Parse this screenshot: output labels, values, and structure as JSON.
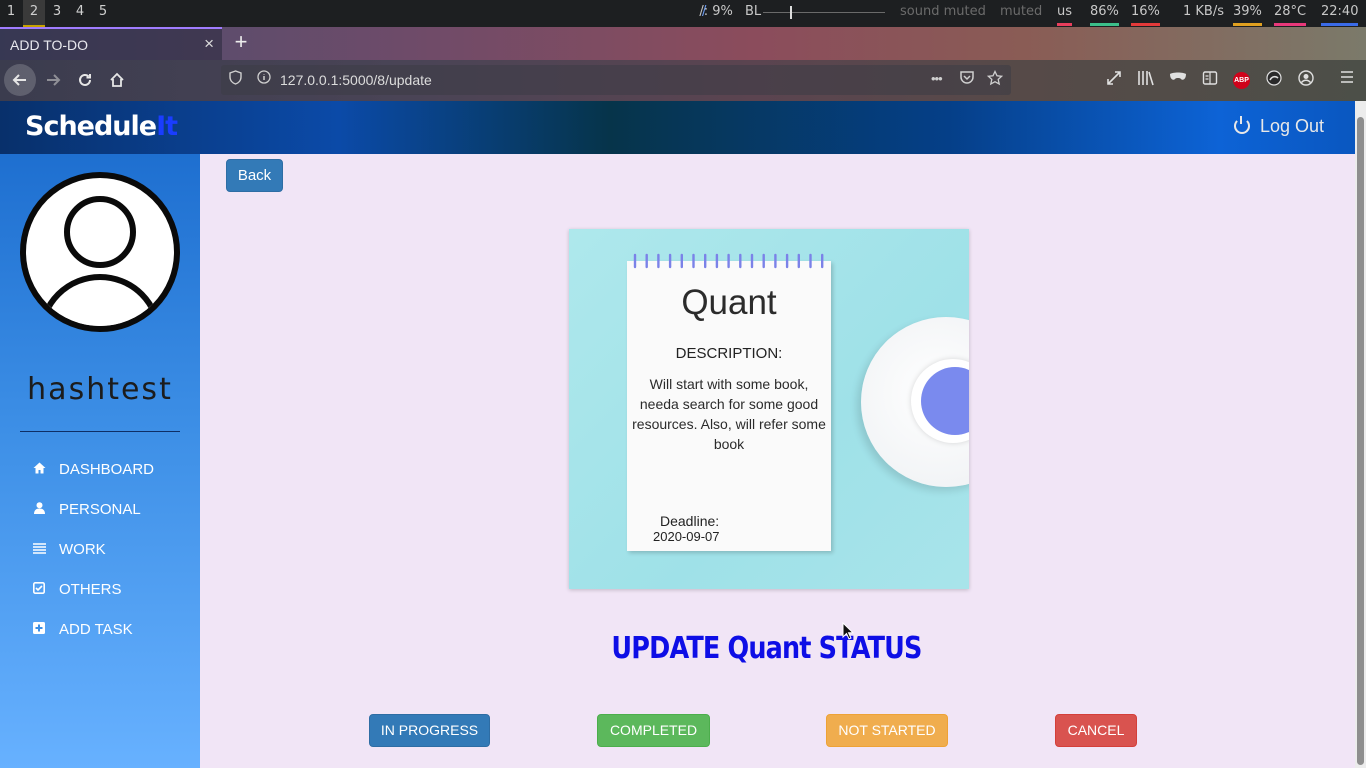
{
  "system_bar": {
    "workspaces": [
      "1",
      "2",
      "3",
      "4",
      "5"
    ],
    "active_workspace": "2",
    "cpu_label": "/: 9%",
    "brightness_label": "BL",
    "sound_label": "sound muted",
    "mic_label": "muted",
    "keyboard_layout": "us",
    "memory": "86%",
    "swap": "16%",
    "network": "1 KB/s",
    "battery": "39%",
    "temperature": "28°C",
    "clock": "22:40"
  },
  "browser": {
    "tab_title": "ADD TO-DO",
    "tab_close": "×",
    "new_tab": "+",
    "url": "127.0.0.1:5000/8/update",
    "url_more": "•••"
  },
  "app": {
    "brand_main": "Schedule",
    "brand_accent": "It",
    "logout_label": "Log Out"
  },
  "sidebar": {
    "username": "hashtest",
    "items": [
      {
        "label": "DASHBOARD",
        "icon": "home-icon"
      },
      {
        "label": "PERSONAL",
        "icon": "user-icon"
      },
      {
        "label": "WORK",
        "icon": "list-icon"
      },
      {
        "label": "OTHERS",
        "icon": "check-square-icon"
      },
      {
        "label": "ADD TASK",
        "icon": "plus-square-icon"
      }
    ]
  },
  "main": {
    "back_label": "Back",
    "task": {
      "title": "Quant",
      "description_label": "DESCRIPTION:",
      "description": "Will start with some book, needa search for some good resources. Also, will refer some book",
      "deadline_label": "Deadline:",
      "deadline": "2020-09-07"
    },
    "update_title": "UPDATE Quant STATUS",
    "status_buttons": {
      "in_progress": "IN PROGRESS",
      "completed": "COMPLETED",
      "not_started": "NOT STARTED",
      "cancel": "CANCEL"
    }
  },
  "colors": {
    "header_bg": "#0b4aa8",
    "sidebar_bg": "#3d8fe6",
    "page_bg": "#f1e5f6",
    "title_blue": "#0e0ee6",
    "btn_primary": "#337ab7",
    "btn_success": "#5cb85c",
    "btn_warning": "#f0ad4e",
    "btn_danger": "#d9534f"
  }
}
